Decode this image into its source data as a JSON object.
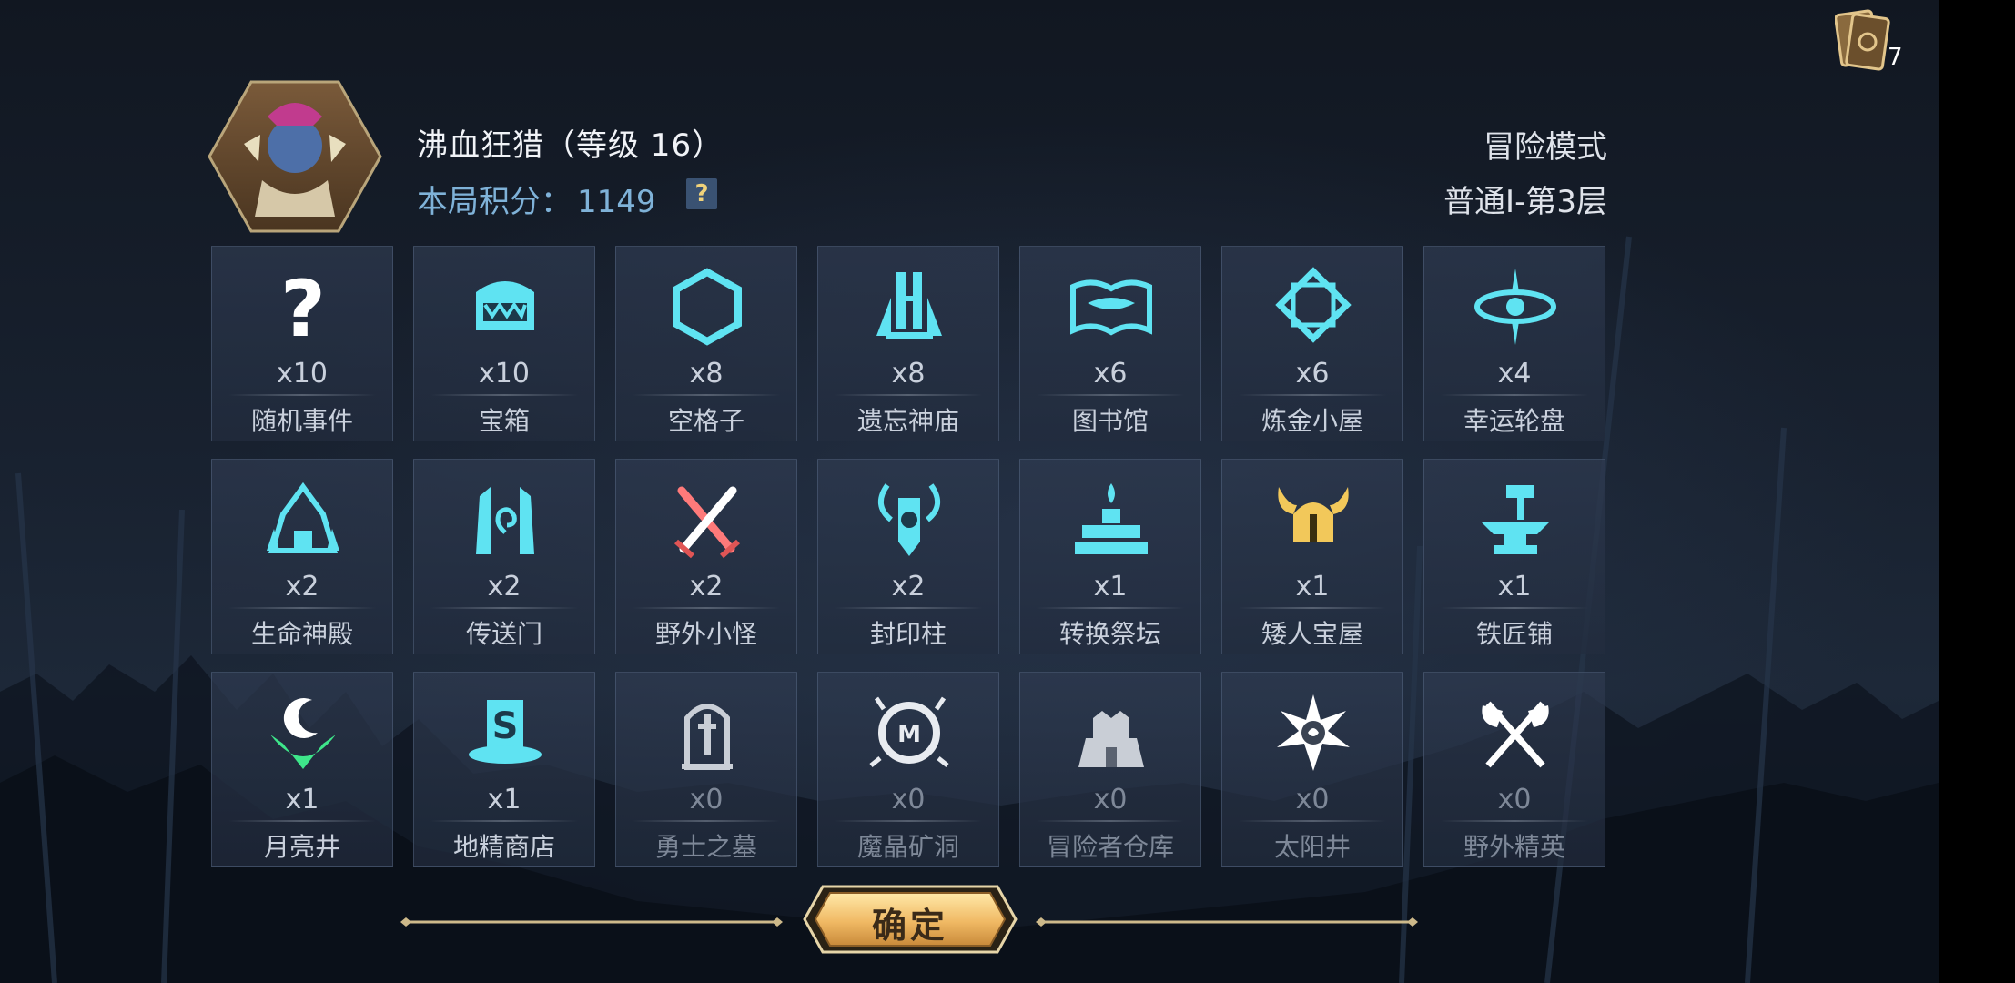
{
  "deck": {
    "count": "7",
    "icon": "card-deck-icon"
  },
  "player": {
    "name": "沸血狂猎（等级 16）",
    "score_label": "本局积分：",
    "score_value": "1149",
    "help": "?"
  },
  "mode": {
    "title": "冒险模式",
    "floor": "普通Ⅰ-第3层"
  },
  "tiles": [
    {
      "label": "随机事件",
      "count": "x10",
      "icon": "question-mark-icon"
    },
    {
      "label": "宝箱",
      "count": "x10",
      "icon": "treasure-chest-icon"
    },
    {
      "label": "空格子",
      "count": "x8",
      "icon": "empty-hexagon-icon"
    },
    {
      "label": "遗忘神庙",
      "count": "x8",
      "icon": "forgotten-temple-icon"
    },
    {
      "label": "图书馆",
      "count": "x6",
      "icon": "library-book-icon"
    },
    {
      "label": "炼金小屋",
      "count": "x6",
      "icon": "alchemy-diamond-icon"
    },
    {
      "label": "幸运轮盘",
      "count": "x4",
      "icon": "lucky-wheel-icon"
    },
    {
      "label": "生命神殿",
      "count": "x2",
      "icon": "life-temple-icon"
    },
    {
      "label": "传送门",
      "count": "x2",
      "icon": "portal-icon"
    },
    {
      "label": "野外小怪",
      "count": "x2",
      "icon": "crossed-swords-icon"
    },
    {
      "label": "封印柱",
      "count": "x2",
      "icon": "seal-pillar-icon"
    },
    {
      "label": "转换祭坛",
      "count": "x1",
      "icon": "altar-icon"
    },
    {
      "label": "矮人宝屋",
      "count": "x1",
      "icon": "dwarf-helmet-icon"
    },
    {
      "label": "铁匠铺",
      "count": "x1",
      "icon": "anvil-hammer-icon"
    },
    {
      "label": "月亮井",
      "count": "x1",
      "icon": "moon-well-icon"
    },
    {
      "label": "地精商店",
      "count": "x1",
      "icon": "goblin-shop-icon"
    },
    {
      "label": "勇士之墓",
      "count": "x0",
      "icon": "tombstone-icon"
    },
    {
      "label": "魔晶矿洞",
      "count": "x0",
      "icon": "crystal-mine-icon"
    },
    {
      "label": "冒险者仓库",
      "count": "x0",
      "icon": "warehouse-icon"
    },
    {
      "label": "太阳井",
      "count": "x0",
      "icon": "sun-well-icon"
    },
    {
      "label": "野外精英",
      "count": "x0",
      "icon": "crossed-axes-icon"
    }
  ],
  "confirm": {
    "label": "确定"
  },
  "colors": {
    "accent": "#5fe3f2",
    "gold": "#f2c85a",
    "score": "#7fb2d8"
  }
}
